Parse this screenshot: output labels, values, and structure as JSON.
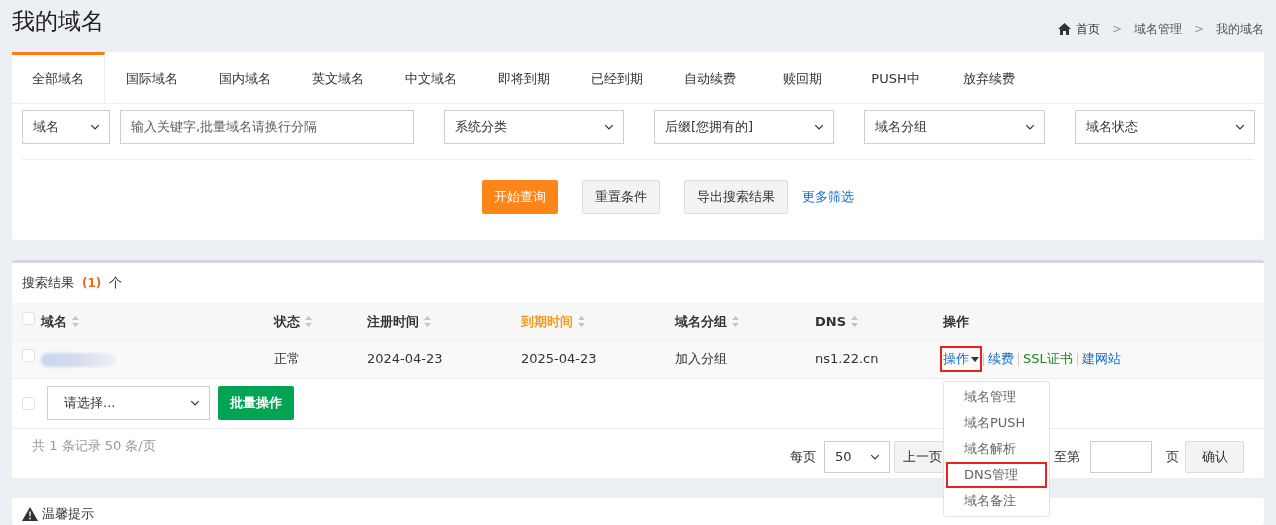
{
  "page_title": "我的域名",
  "breadcrumb": [
    {
      "label": "首页",
      "kind": "home"
    },
    {
      "label": "域名管理",
      "kind": "link"
    },
    {
      "label": "我的域名",
      "kind": "current"
    }
  ],
  "breadcrumb_separator": ">",
  "tabs": [
    {
      "label": "全部域名",
      "selected": true
    },
    {
      "label": "国际域名",
      "selected": false
    },
    {
      "label": "国内域名",
      "selected": false
    },
    {
      "label": "英文域名",
      "selected": false
    },
    {
      "label": "中文域名",
      "selected": false
    },
    {
      "label": "即将到期",
      "selected": false
    },
    {
      "label": "已经到期",
      "selected": false
    },
    {
      "label": "自动续费",
      "selected": false
    },
    {
      "label": "赎回期",
      "selected": false
    },
    {
      "label": "PUSH中",
      "selected": false
    },
    {
      "label": "放弃续费",
      "selected": false
    }
  ],
  "filters": [
    {
      "kind": "select",
      "value": "域名"
    },
    {
      "kind": "input",
      "placeholder": "输入关键字,批量域名请换行分隔"
    },
    {
      "kind": "select",
      "value": "系统分类"
    },
    {
      "kind": "select",
      "value": "后缀[您拥有的]"
    },
    {
      "kind": "select",
      "value": "域名分组"
    },
    {
      "kind": "select",
      "value": "域名状态"
    }
  ],
  "filter_actions": [
    {
      "label": "开始查询",
      "kind": "primary"
    },
    {
      "label": "重置条件",
      "kind": "secondary"
    },
    {
      "label": "导出搜索结果",
      "kind": "secondary"
    },
    {
      "label": "更多筛选",
      "kind": "link"
    }
  ],
  "results": {
    "label": "搜索结果",
    "count": "(1)",
    "unit": "个"
  },
  "table": {
    "columns": [
      {
        "label": "域名",
        "sortable": true,
        "highlighted": false
      },
      {
        "label": "状态",
        "sortable": true,
        "highlighted": false
      },
      {
        "label": "注册时间",
        "sortable": true,
        "highlighted": false
      },
      {
        "label": "到期时间",
        "sortable": true,
        "highlighted": true
      },
      {
        "label": "域名分组",
        "sortable": true,
        "highlighted": false
      },
      {
        "label": "DNS",
        "sortable": true,
        "highlighted": false
      },
      {
        "label": "操作",
        "sortable": false,
        "highlighted": false
      }
    ],
    "header_checked": false,
    "rows": [
      {
        "checked": false,
        "domain_redacted": true,
        "status": "正常",
        "registered": "2024-04-23",
        "expires": "2025-04-23",
        "group": "加入分组",
        "dns": "ns1.22.cn",
        "actions": [
          {
            "label": "操作",
            "kind": "dropdown",
            "highlighted": true
          },
          {
            "label": "续费",
            "kind": "link"
          },
          {
            "label": "SSL证书",
            "kind": "ssl"
          },
          {
            "label": "建网站",
            "kind": "link"
          }
        ],
        "menu": [
          {
            "label": "域名管理",
            "highlighted": false
          },
          {
            "label": "域名PUSH",
            "highlighted": false
          },
          {
            "label": "域名解析",
            "highlighted": false
          },
          {
            "label": "DNS管理",
            "highlighted": true
          },
          {
            "label": "域名备注",
            "highlighted": false
          }
        ]
      }
    ]
  },
  "batch": {
    "checked": false,
    "select": "请选择...",
    "button": "批量操作"
  },
  "pagination": {
    "summary": "共 1 条记录 50 条/页",
    "per_page_label": "每页",
    "per_page": "50",
    "prev": "上一页",
    "goto_label": "至第",
    "page_unit": "页",
    "confirm": "确认"
  },
  "notice": {
    "title": "温馨提示"
  }
}
